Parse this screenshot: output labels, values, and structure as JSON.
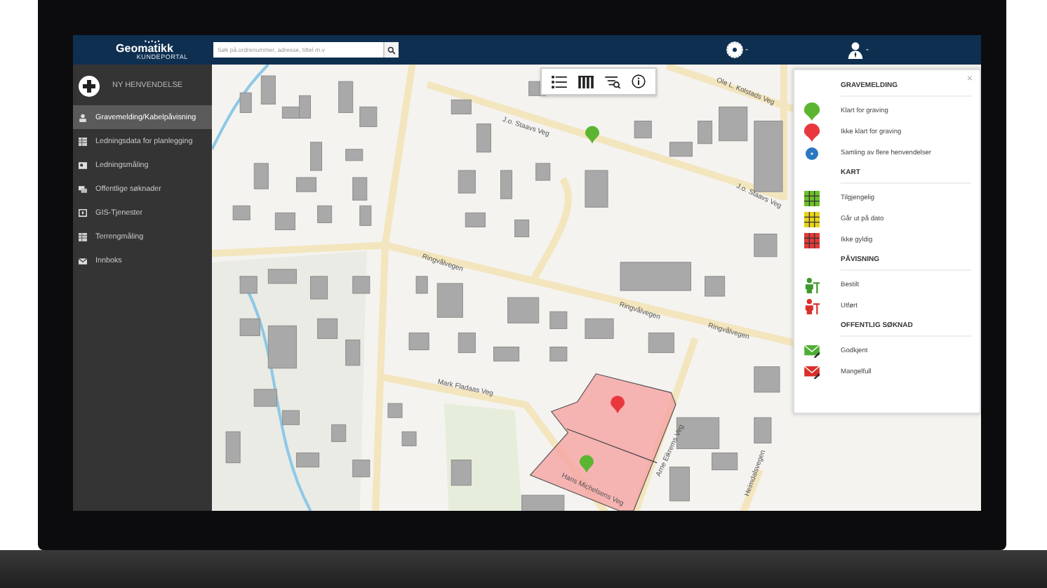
{
  "header": {
    "logo_title": "Geomatikk",
    "logo_subtitle": "KUNDEPORTAL",
    "search": {
      "placeholder": "Søk på ordrenummer, adresse, tittel m.v"
    },
    "settings_caret": "-",
    "user_caret": "-"
  },
  "sidebar": {
    "new_request": "NY HENVENDELSE",
    "items": [
      {
        "label": "Gravemelding/Kabelpåvisning",
        "selected": true
      },
      {
        "label": "Ledningsdata for planlegging",
        "selected": false
      },
      {
        "label": "Ledningsmåling",
        "selected": false
      },
      {
        "label": "Offentlige søknader",
        "selected": false
      },
      {
        "label": "GIS-Tjenester",
        "selected": false
      },
      {
        "label": "Terrengmåling",
        "selected": false
      },
      {
        "label": "Innboks",
        "selected": false
      }
    ]
  },
  "map": {
    "street_labels": [
      "Ringvålvegen",
      "Ringvålvegen",
      "Ringvålvegen",
      "Mark Fladaas Veg",
      "Hans Michelsens Veg",
      "J.o. Staavs Veg",
      "J.o. Staavs Veg",
      "Ole L. Kolstads Veg",
      "Arne Eikrems Veg",
      "Heimdalsvegen"
    ],
    "markers": [
      {
        "color": "#5cb531"
      },
      {
        "color": "#e8383d"
      },
      {
        "color": "#5cb531"
      }
    ]
  },
  "legend": {
    "close": "×",
    "sections": [
      {
        "title": "GRAVEMELDING",
        "items": [
          {
            "kind": "pin",
            "color": "#5cb531",
            "label": "Klart for graving"
          },
          {
            "kind": "pin",
            "color": "#e8383d",
            "label": "Ikke klart for graving"
          },
          {
            "kind": "cluster",
            "color": "#2a78c2",
            "label": "Samling av flere henvendelser"
          }
        ]
      },
      {
        "title": "KART",
        "items": [
          {
            "kind": "grid",
            "color": "#6cbf2a",
            "label": "Tilgjengelig"
          },
          {
            "kind": "grid",
            "color": "#e8d21c",
            "label": "Går ut på dato"
          },
          {
            "kind": "grid",
            "color": "#e23a3a",
            "label": "Ikke gyldig"
          }
        ]
      },
      {
        "title": "PÅVISNING",
        "items": [
          {
            "kind": "worker",
            "color": "#3f9a2c",
            "label": "Bestilt"
          },
          {
            "kind": "worker",
            "color": "#d9302c",
            "label": "Utført"
          }
        ]
      },
      {
        "title": "OFFENTLIG SØKNAD",
        "items": [
          {
            "kind": "envelope",
            "color": "#4fae34",
            "label": "Godkjent"
          },
          {
            "kind": "envelope",
            "color": "#d9302c",
            "label": "Mangelfull"
          }
        ]
      }
    ]
  }
}
